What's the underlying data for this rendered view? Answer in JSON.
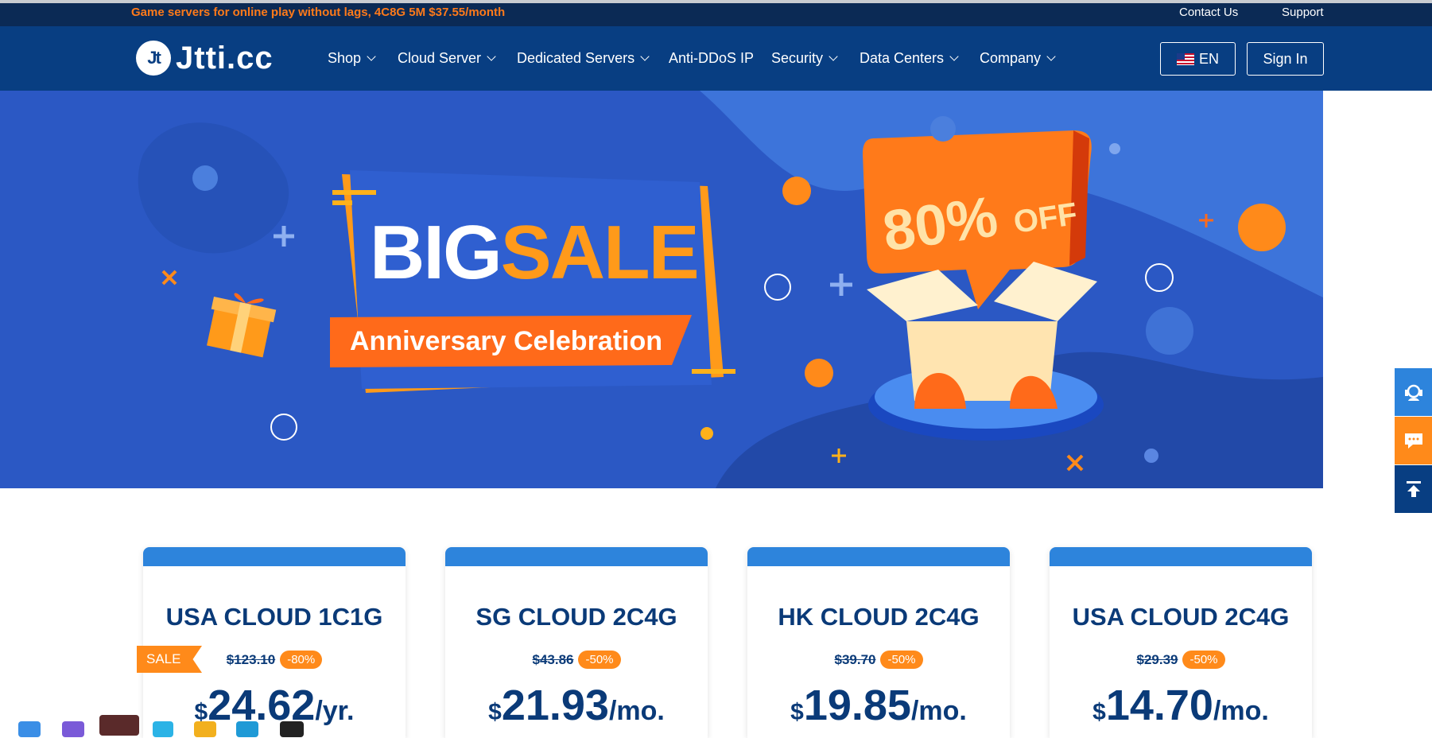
{
  "topbar": {
    "promo": "Game servers for online play without lags, 4C8G 5M $37.55/month",
    "contact": "Contact Us",
    "support": "Support"
  },
  "header": {
    "logo_badge": "Jt",
    "logo_text": "Jtti.cc",
    "nav": [
      {
        "label": "Shop"
      },
      {
        "label": "Cloud Server"
      },
      {
        "label": "Dedicated Servers"
      },
      {
        "label": "Anti-DDoS IP"
      },
      {
        "label": "Security"
      },
      {
        "label": "Data Centers"
      },
      {
        "label": "Company"
      }
    ],
    "lang": "EN",
    "signin": "Sign In"
  },
  "banner": {
    "big": "BIG",
    "sale": "SALE",
    "subtitle": "Anniversary Celebration",
    "off_pct": "80%",
    "off_word": "OFF"
  },
  "sale_tag": "SALE",
  "cards": [
    {
      "title": "USA CLOUD 1C1G",
      "old_price": "$123.10",
      "discount": "-80%",
      "currency": "$",
      "price": "24.62",
      "unit": "/yr."
    },
    {
      "title": "SG CLOUD 2C4G",
      "old_price": "$43.86",
      "discount": "-50%",
      "currency": "$",
      "price": "21.93",
      "unit": "/mo."
    },
    {
      "title": "HK CLOUD 2C4G",
      "old_price": "$39.70",
      "discount": "-50%",
      "currency": "$",
      "price": "19.85",
      "unit": "/mo."
    },
    {
      "title": "USA CLOUD 2C4G",
      "old_price": "$29.39",
      "discount": "-50%",
      "currency": "$",
      "price": "14.70",
      "unit": "/mo."
    }
  ],
  "colors": {
    "topbar": "#0b2a55",
    "header": "#083e82",
    "banner": "#2b58c4",
    "accent": "#ff8a1a",
    "card_top": "#2d84dc",
    "text_dark": "#0a3a78"
  }
}
